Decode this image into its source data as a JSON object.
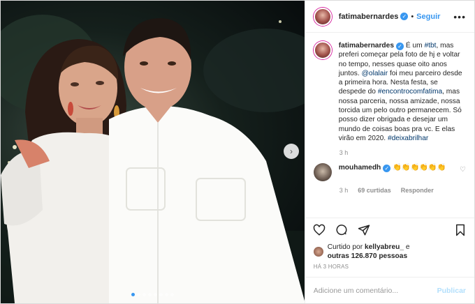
{
  "post": {
    "username": "fatimabernardes",
    "follow_label": "Seguir",
    "separator": "•",
    "more_label": "•••",
    "next_label": "›"
  },
  "caption": {
    "username": "fatimabernardes",
    "part1": " É um ",
    "tag_tbt": "#tbt",
    "part2": ", mas preferi começar pela foto de hj e voltar no tempo, nesses quase oito anos juntos. ",
    "mention": "@olalair",
    "part3": " foi meu parceiro desde a primeira hora. Nesta festa, se despede do ",
    "tag_encontro": "#encontrocomfatima",
    "part4": ", mas nossa parceria, nossa amizade, nossa torcida um pelo outro permanecem. Só posso dizer obrigada e desejar um mundo de coisas boas pra vc. E elas virão em 2020. ",
    "tag_deixa": "#deixabrilhar",
    "time": "3 h"
  },
  "comment": {
    "username": "mouhamedh",
    "text": " 👏👏👏👏👏👏",
    "time": "3 h",
    "likes": "69 curtidas",
    "reply_label": "Responder"
  },
  "likes": {
    "prefix": "Curtido por ",
    "user": "kellyabreu_",
    "middle": " e",
    "others": "outras 126.870 pessoas"
  },
  "timestamp": "HÁ 3 HORAS",
  "add_comment": {
    "placeholder": "Adicione um comentário...",
    "publish_label": "Publicar"
  },
  "carousel": {
    "count": 8,
    "active_index": 0
  },
  "colors": {
    "accent": "#3897f0",
    "publish_disabled": "#b2dffc",
    "link": "#00376b"
  },
  "icons": [
    "verified-icon",
    "heart-icon",
    "comment-icon",
    "share-icon",
    "bookmark-icon",
    "more-icon",
    "chevron-right-icon"
  ]
}
